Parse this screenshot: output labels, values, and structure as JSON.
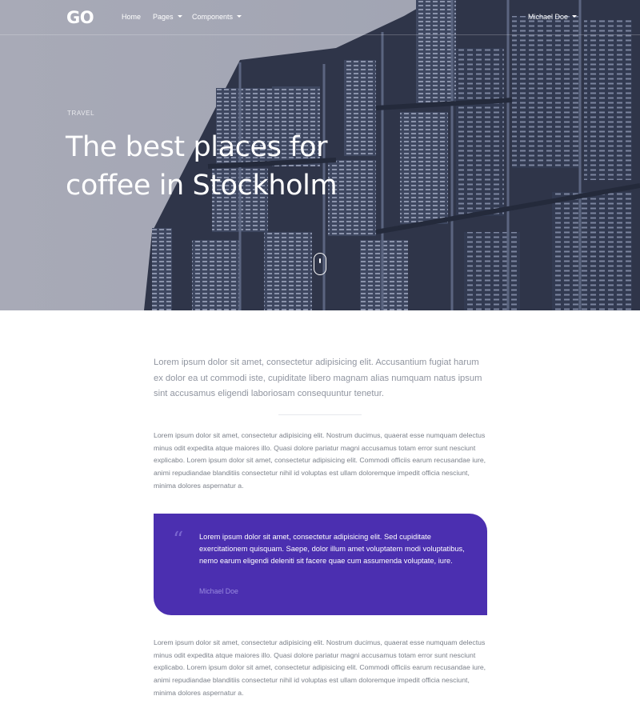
{
  "navbar": {
    "logo": "GO",
    "items": [
      {
        "label": "Home",
        "dropdown": false
      },
      {
        "label": "Pages",
        "dropdown": true
      },
      {
        "label": "Components",
        "dropdown": true
      }
    ],
    "user": {
      "label": "Michael Doe",
      "dropdown": true
    }
  },
  "hero": {
    "eyebrow": "TRAVEL",
    "title_lines": [
      "The best places for",
      "coffee in Stockholm"
    ]
  },
  "article": {
    "lead": "Lorem ipsum dolor sit amet, consectetur adipisicing elit. Accusantium fugiat harum ex dolor ea ut commodi iste, cupiditate libero magnam alias numquam natus ipsum sint accusamus eligendi laboriosam consequuntur tenetur.",
    "paragraph_1": "Lorem ipsum dolor sit amet, consectetur adipisicing elit. Nostrum ducimus, quaerat esse numquam delectus minus odit expedita atque maiores illo. Quasi dolore pariatur magni accusamus totam error sunt nesciunt explicabo. Lorem ipsum dolor sit amet, consectetur adipisicing elit. Commodi officiis earum recusandae iure, animi repudiandae blanditiis consectetur nihil id voluptas est ullam doloremque impedit officia nesciunt, minima dolores aspernatur a.",
    "quote": {
      "mark": "“",
      "text": "Lorem ipsum dolor sit amet, consectetur adipisicing elit. Sed cupiditate exercitationem quisquam. Saepe, dolor illum amet voluptatem modi voluptatibus, nemo earum eligendi deleniti sit facere quae cum assumenda voluptate, iure.",
      "author": "Michael Doe"
    },
    "paragraph_2": "Lorem ipsum dolor sit amet, consectetur adipisicing elit. Nostrum ducimus, quaerat esse numquam delectus minus odit expedita atque maiores illo. Quasi dolore pariatur magni accusamus totam error sunt nesciunt explicabo. Lorem ipsum dolor sit amet, consectetur adipisicing elit. Commodi officiis earum recusandae iure, animi repudiandae blanditiis consectetur nihil id voluptas est ullam doloremque impedit officia nesciunt, minima dolores aspernatur a."
  },
  "colors": {
    "hero_sky": "#a3a6b3",
    "building": "#3b4257",
    "accent": "#4b2fb0",
    "body_text": "#7b808a"
  },
  "icons": {
    "logo_mark": "go-logo-icon",
    "scroll": "mouse-scroll-icon",
    "quote": "quote-mark-icon",
    "caret": "caret-down-icon"
  }
}
